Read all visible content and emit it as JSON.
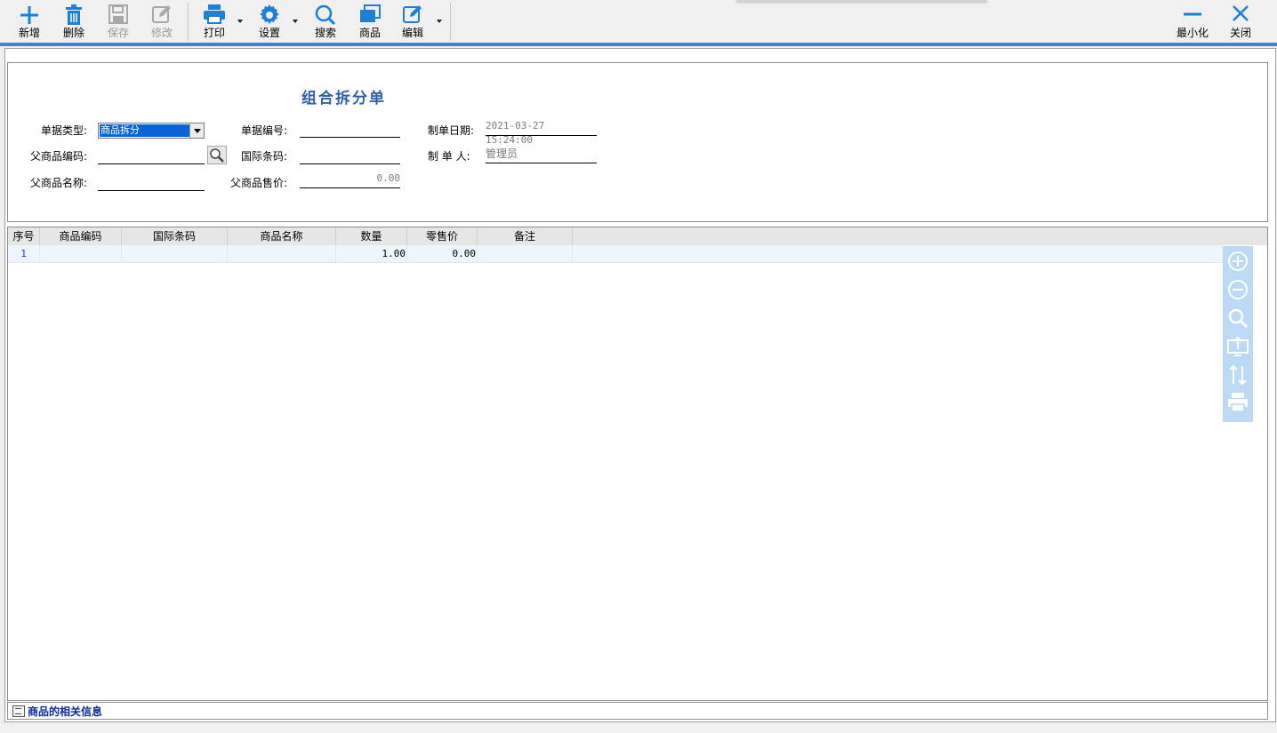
{
  "toolbar": {
    "new_label": "新增",
    "delete_label": "删除",
    "save_label": "保存",
    "modify_label": "修改",
    "print_label": "打印",
    "settings_label": "设置",
    "search_label": "搜索",
    "product_label": "商品",
    "edit_label": "编辑",
    "minimize_label": "最小化",
    "close_label": "关闭"
  },
  "form": {
    "title": "组合拆分单",
    "doc_type_label": "单据类型:",
    "doc_type_value": "商品拆分",
    "doc_no_label": "单据编号:",
    "doc_no_value": "",
    "date_label": "制单日期:",
    "date_value": "2021-03-27 15:24:00",
    "parent_code_label": "父商品编码:",
    "parent_code_value": "",
    "barcode_label": "国际条码:",
    "barcode_value": "",
    "creator_label": "制 单 人:",
    "creator_value": "管理员",
    "parent_name_label": "父商品名称:",
    "parent_name_value": "",
    "parent_price_label": "父商品售价:",
    "parent_price_value": "0.00"
  },
  "grid": {
    "columns": [
      "序号",
      "商品编码",
      "国际条码",
      "商品名称",
      "数量",
      "零售价",
      "备注"
    ],
    "rows": [
      {
        "seq": "1",
        "code": "",
        "barcode": "",
        "name": "",
        "qty": "1.00",
        "price": "0.00",
        "note": ""
      }
    ]
  },
  "footer": {
    "info_label": "商品的相关信息"
  },
  "colors": {
    "accent": "#3d86cf",
    "icon_blue": "#1e7fd6",
    "title_blue": "#2f5fa8",
    "side_panel": "#bcdaf6"
  }
}
